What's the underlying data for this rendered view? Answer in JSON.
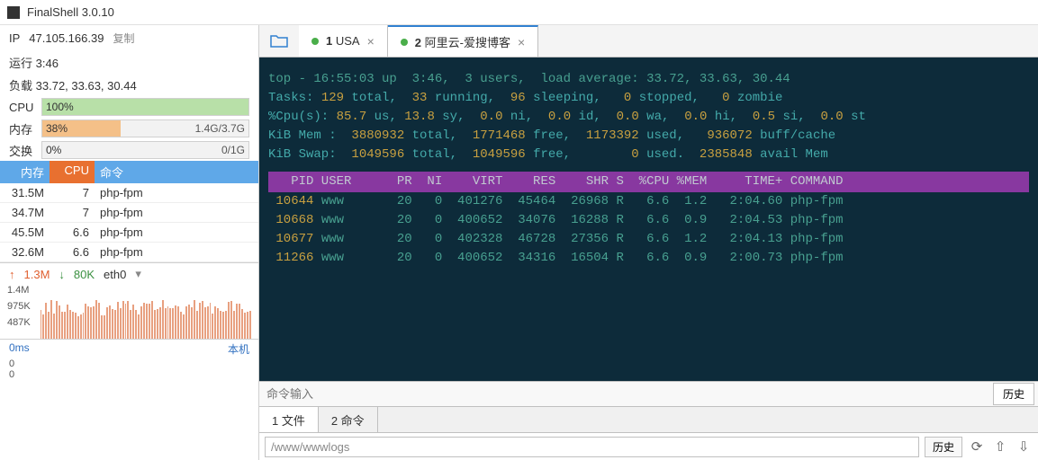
{
  "title": "FinalShell 3.0.10",
  "sidebar": {
    "ip_label": "IP",
    "ip": "47.105.166.39",
    "copy": "复制",
    "uptime_label": "运行",
    "uptime": "3:46",
    "load_label": "负载",
    "load": "33.72, 33.63, 30.44",
    "cpu_label": "CPU",
    "cpu_pct": "100%",
    "mem_label": "内存",
    "mem_pct": "38%",
    "mem_val": "1.4G/3.7G",
    "swap_label": "交换",
    "swap_pct": "0%",
    "swap_val": "0/1G",
    "headers": {
      "mem": "内存",
      "cpu": "CPU",
      "cmd": "命令"
    },
    "procs": [
      {
        "mem": "31.5M",
        "cpu": "7",
        "cmd": "php-fpm"
      },
      {
        "mem": "34.7M",
        "cpu": "7",
        "cmd": "php-fpm"
      },
      {
        "mem": "45.5M",
        "cpu": "6.6",
        "cmd": "php-fpm"
      },
      {
        "mem": "32.6M",
        "cpu": "6.6",
        "cmd": "php-fpm"
      }
    ],
    "net": {
      "up": "1.3M",
      "down": "80K",
      "iface": "eth0"
    },
    "chart_y": [
      "1.4M",
      "975K",
      "487K"
    ],
    "ms": "0ms",
    "local": "本机",
    "zeros": [
      "0",
      "0"
    ]
  },
  "tabs": [
    {
      "num": "1",
      "label": "USA"
    },
    {
      "num": "2",
      "label": "阿里云-爱搜博客"
    }
  ],
  "terminal": {
    "l1a": "top - 16:55:03 up  3:46,  3 users,  load average: 33.72, 33.63, 30.44",
    "l2": "Tasks: 129 total,  33 running,  96 sleeping,   0 stopped,   0 zombie",
    "l3": "%Cpu(s): 85.7 us, 13.8 sy,  0.0 ni,  0.0 id,  0.0 wa,  0.0 hi,  0.5 si,  0.0 st",
    "l4": "KiB Mem :  3880932 total,  1771468 free,  1173392 used,   936072 buff/cache",
    "l5": "KiB Swap:  1049596 total,  1049596 free,        0 used.  2385848 avail Mem",
    "hdr": "   PID USER      PR  NI    VIRT    RES    SHR S  %CPU %MEM     TIME+ COMMAND",
    "rows": [
      " 10644 www       20   0  401276  45464  26968 R   6.6  1.2   2:04.60 php-fpm",
      " 10668 www       20   0  400652  34076  16288 R   6.6  0.9   2:04.53 php-fpm",
      " 10677 www       20   0  402328  46728  27356 R   6.6  1.2   2:04.13 php-fpm",
      " 11266 www       20   0  400652  34316  16504 R   6.6  0.9   2:00.73 php-fpm"
    ]
  },
  "cmd_placeholder": "命令输入",
  "history": "历史",
  "bottom_tabs": [
    "1 文件",
    "2 命令"
  ],
  "path": "/www/wwwlogs"
}
